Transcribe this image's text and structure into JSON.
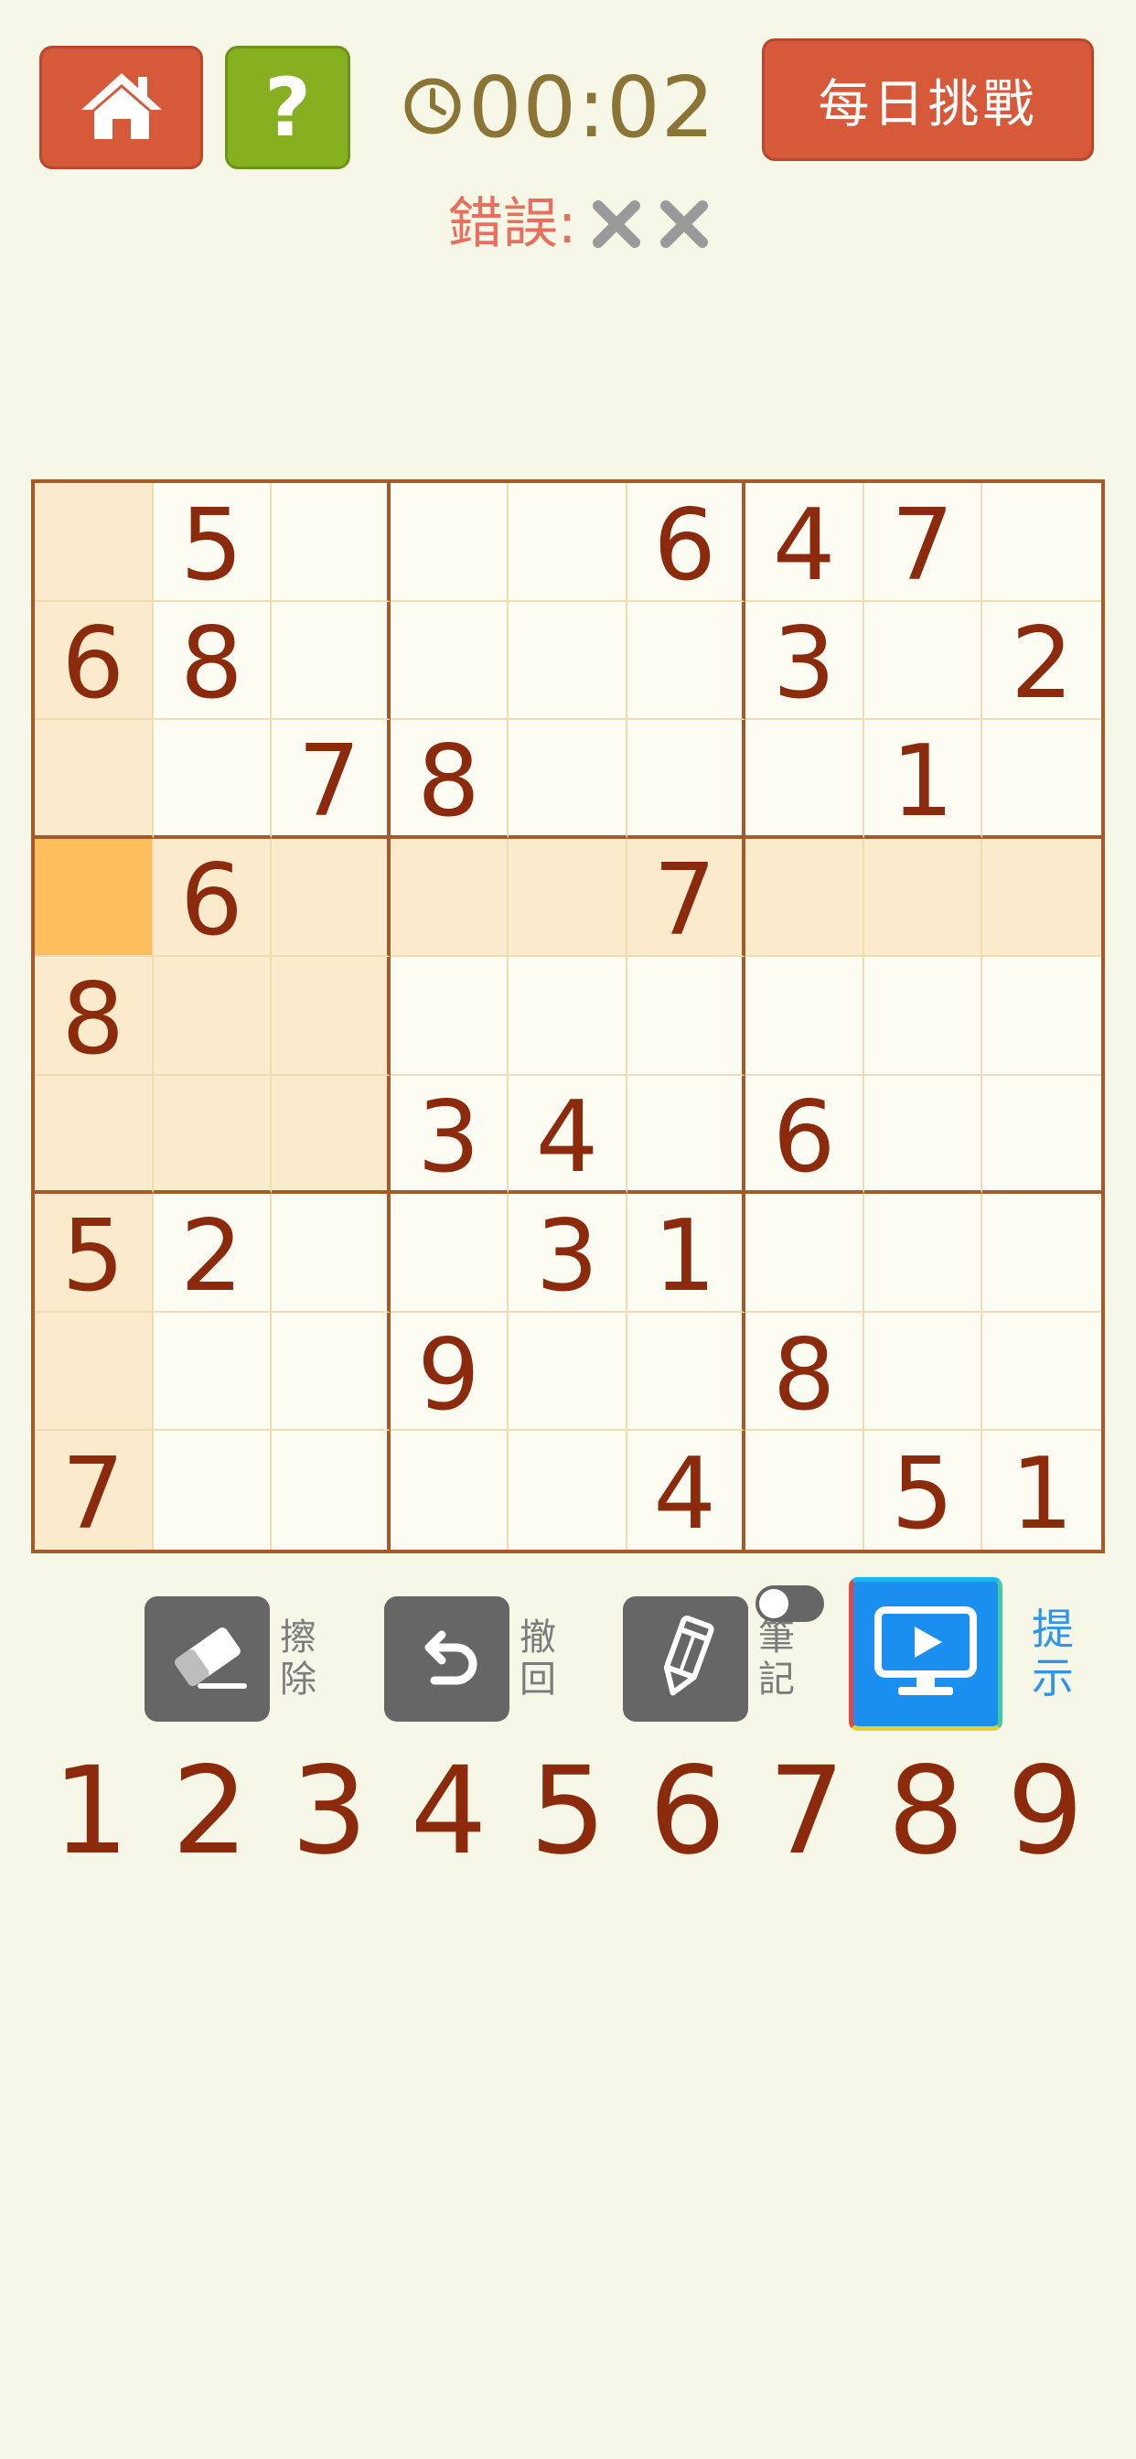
{
  "header": {
    "home_icon": "house-icon",
    "help_label": "?",
    "timer_icon": "clock-icon",
    "timer": "00:02",
    "daily_challenge": "每日挑戰"
  },
  "errors": {
    "label": "錯誤:",
    "marks": 2,
    "mark_icon": "x-icon"
  },
  "board": {
    "selected": {
      "row": 4,
      "col": 1
    },
    "rows": [
      [
        "",
        "5",
        "",
        "",
        "",
        "6",
        "4",
        "7",
        ""
      ],
      [
        "6",
        "8",
        "",
        "",
        "",
        "",
        "3",
        "",
        "2"
      ],
      [
        "",
        "",
        "7",
        "8",
        "",
        "",
        "",
        "1",
        ""
      ],
      [
        "",
        "6",
        "",
        "",
        "",
        "7",
        "",
        "",
        ""
      ],
      [
        "8",
        "",
        "",
        "",
        "",
        "",
        "",
        "",
        ""
      ],
      [
        "",
        "",
        "",
        "3",
        "4",
        "",
        "6",
        "",
        ""
      ],
      [
        "5",
        "2",
        "",
        "",
        "3",
        "1",
        "",
        "",
        ""
      ],
      [
        "",
        "",
        "",
        "9",
        "",
        "",
        "8",
        "",
        ""
      ],
      [
        "7",
        "",
        "",
        "",
        "",
        "4",
        "",
        "5",
        "1"
      ]
    ]
  },
  "tools": {
    "erase": "擦除",
    "undo": "撤回",
    "notes": "筆記",
    "hint": "提示",
    "notes_toggle_on": false
  },
  "numpad": [
    "1",
    "2",
    "3",
    "4",
    "5",
    "6",
    "7",
    "8",
    "9"
  ],
  "colors": {
    "background": "#f6f7e6",
    "accent_red": "#d65a3a",
    "accent_green": "#86b020",
    "digit": "#8b2a0c",
    "highlight": "#fbeacb",
    "selected": "#ffbe5c",
    "hint_blue": "#1a8ff0"
  }
}
